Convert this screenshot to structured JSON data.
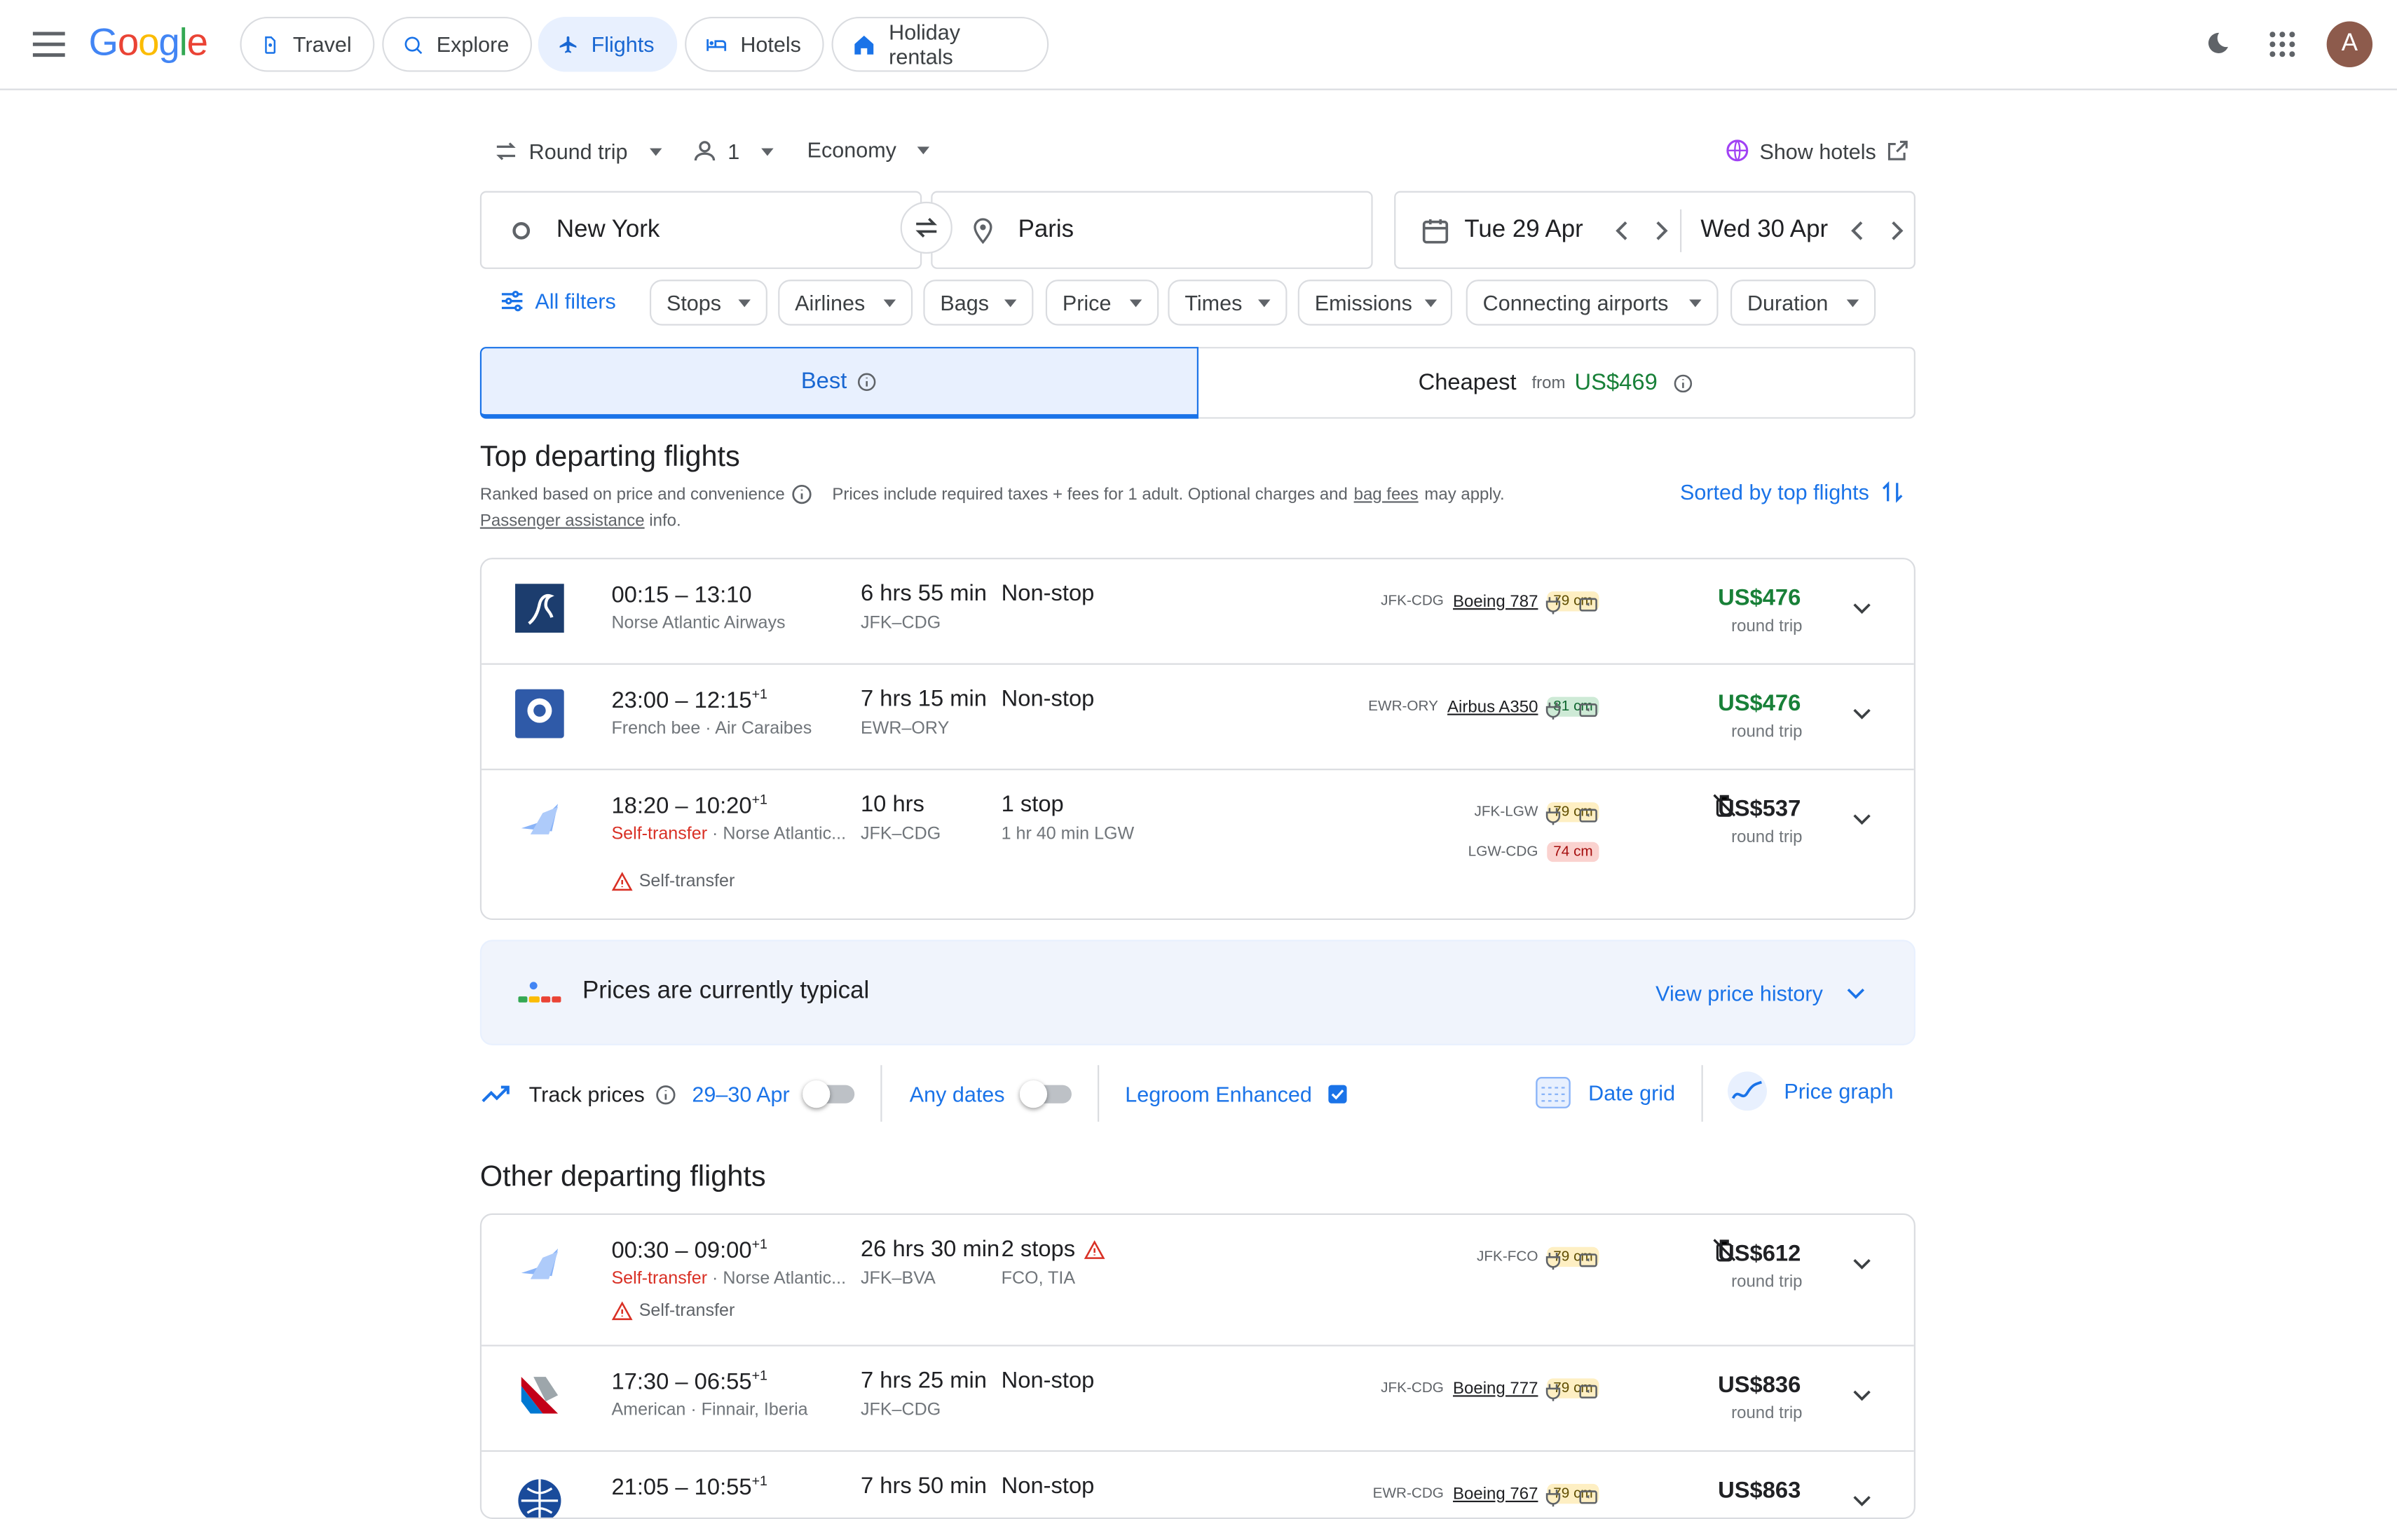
{
  "header": {
    "logo": "Google",
    "nav": [
      {
        "label": "Travel",
        "icon": "travel-tag-icon",
        "active": false
      },
      {
        "label": "Explore",
        "icon": "explore-icon",
        "active": false
      },
      {
        "label": "Flights",
        "icon": "flights-icon",
        "active": true
      },
      {
        "label": "Hotels",
        "icon": "hotels-icon",
        "active": false
      },
      {
        "label": "Holiday rentals",
        "icon": "holiday-rentals-icon",
        "active": false
      }
    ],
    "avatar_letter": "A",
    "colors": {
      "active_nav_bg": "#e8f0fe",
      "active_nav_text": "#1967d2",
      "avatar_bg": "#8d5b4c"
    }
  },
  "search": {
    "trip_type": "Round trip",
    "passengers": "1",
    "cabin": "Economy",
    "show_hotels": "Show hotels",
    "origin": "New York",
    "destination": "Paris",
    "depart_date": "Tue 29 Apr",
    "return_date": "Wed 30 Apr"
  },
  "filters": {
    "all_filters": "All filters",
    "chips": [
      "Stops",
      "Airlines",
      "Bags",
      "Price",
      "Times",
      "Emissions",
      "Connecting airports",
      "Duration"
    ]
  },
  "tabs": {
    "best": "Best",
    "cheapest": "Cheapest",
    "cheapest_from": "from",
    "cheapest_price": "US$469"
  },
  "top": {
    "title": "Top departing flights",
    "ranked": "Ranked based on price and convenience",
    "prices_note_1": "Prices include required taxes + fees for 1 adult. Optional charges and",
    "bag_fees": "bag fees",
    "prices_note_2": "may apply.",
    "passenger_assistance": "Passenger assistance",
    "info": "info.",
    "sorted_by": "Sorted by top flights"
  },
  "top_flights": [
    {
      "times": "00:15 – 13:10",
      "plus": "",
      "airline": "Norse Atlantic Airways",
      "self_transfer": "",
      "duration": "6 hrs 55 min",
      "route": "JFK–CDG",
      "stops": "Non-stop",
      "stops_detail": "",
      "legs": [
        {
          "code": "JFK-CDG",
          "aircraft": "Boeing 787",
          "legroom": "79 cm",
          "level": "y"
        }
      ],
      "price": "US$476",
      "price_type": "round trip",
      "price_color": "#188038",
      "no_bag": false
    },
    {
      "times": "23:00 – 12:15",
      "plus": "+1",
      "airline": "French bee · Air Caraibes",
      "self_transfer": "",
      "duration": "7 hrs 15 min",
      "route": "EWR–ORY",
      "stops": "Non-stop",
      "stops_detail": "",
      "legs": [
        {
          "code": "EWR-ORY",
          "aircraft": "Airbus A350",
          "legroom": "81 cm",
          "level": "g"
        }
      ],
      "price": "US$476",
      "price_type": "round trip",
      "price_color": "#188038",
      "no_bag": false
    },
    {
      "times": "18:20 – 10:20",
      "plus": "+1",
      "airline": "Norse Atlantic...",
      "self_transfer": "Self-transfer",
      "duration": "10 hrs",
      "route": "JFK–CDG",
      "stops": "1 stop",
      "stops_detail": "1 hr 40 min LGW",
      "legs": [
        {
          "code": "JFK-LGW",
          "aircraft": "",
          "legroom": "79 cm",
          "level": "y"
        },
        {
          "code": "LGW-CDG",
          "aircraft": "",
          "legroom": "74 cm",
          "level": "r"
        }
      ],
      "warning": "Self-transfer",
      "price": "US$537",
      "price_type": "round trip",
      "price_color": "#202124",
      "no_bag": true
    }
  ],
  "price_insight": {
    "text_prefix": "Prices are currently",
    "text_strong": "typical",
    "view_history": "View price history"
  },
  "track": {
    "label": "Track prices",
    "dates": "29–30 Apr",
    "any_dates": "Any dates",
    "legroom": "Legroom Enhanced",
    "date_grid": "Date grid",
    "price_graph": "Price graph"
  },
  "other": {
    "title": "Other departing flights"
  },
  "other_flights": [
    {
      "times": "00:30 – 09:00",
      "plus": "+1",
      "airline": "Norse Atlantic...",
      "self_transfer": "Self-transfer",
      "duration": "26 hrs 30 min",
      "route": "JFK–BVA",
      "stops": "2 stops",
      "stops_detail": "FCO, TIA",
      "legs": [
        {
          "code": "JFK-FCO",
          "aircraft": "",
          "legroom": "79 cm",
          "level": "y"
        }
      ],
      "warning": "Self-transfer",
      "price": "US$612",
      "price_type": "round trip",
      "price_color": "#202124",
      "no_bag": true
    },
    {
      "times": "17:30 – 06:55",
      "plus": "+1",
      "airline": "American · Finnair, Iberia",
      "self_transfer": "",
      "duration": "7 hrs 25 min",
      "route": "JFK–CDG",
      "stops": "Non-stop",
      "stops_detail": "",
      "legs": [
        {
          "code": "JFK-CDG",
          "aircraft": "Boeing 777",
          "legroom": "79 cm",
          "level": "y"
        }
      ],
      "price": "US$836",
      "price_type": "round trip",
      "price_color": "#202124",
      "no_bag": false
    },
    {
      "times": "21:05 – 10:55",
      "plus": "+1",
      "airline": "",
      "self_transfer": "",
      "duration": "7 hrs 50 min",
      "route": "",
      "stops": "Non-stop",
      "stops_detail": "",
      "legs": [
        {
          "code": "EWR-CDG",
          "aircraft": "Boeing 767",
          "legroom": "79 cm",
          "level": "y"
        }
      ],
      "price": "US$863",
      "price_type": "",
      "price_color": "#202124",
      "no_bag": false
    }
  ]
}
